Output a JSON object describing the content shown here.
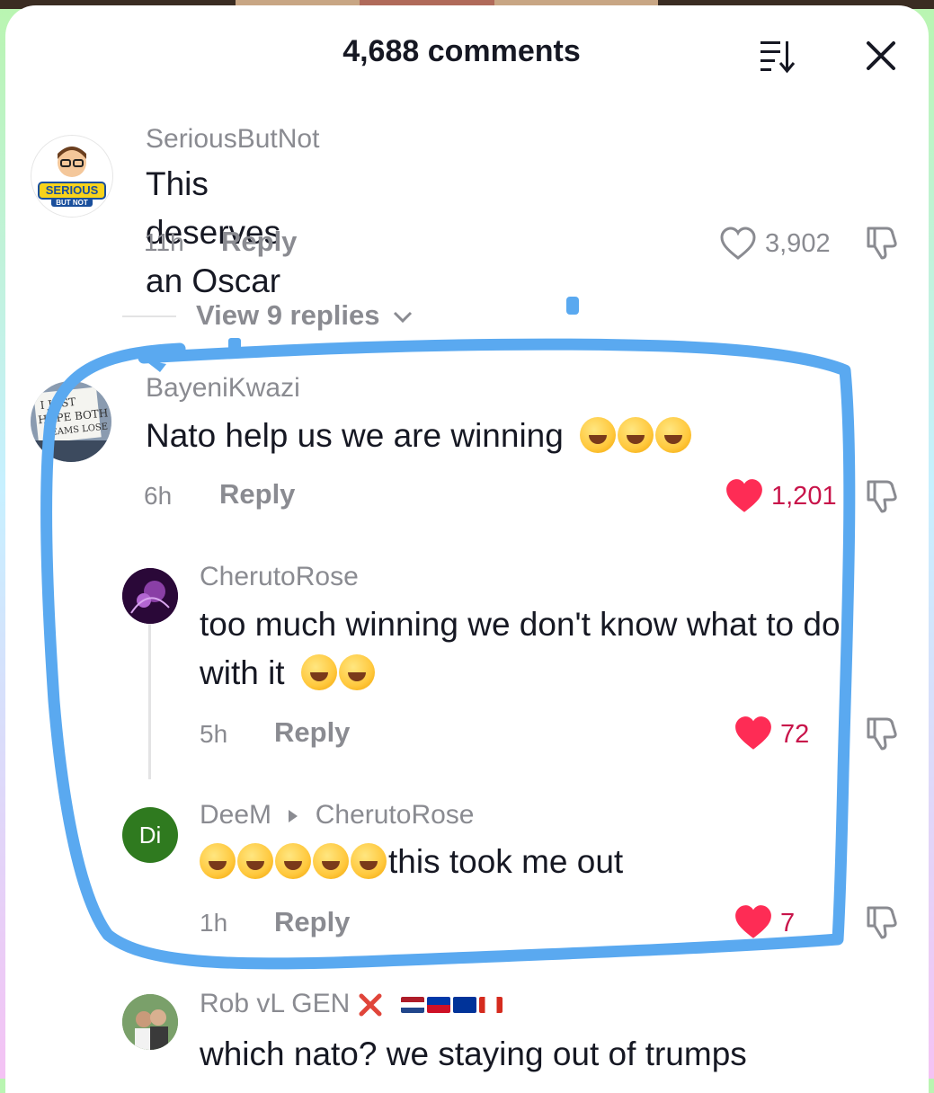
{
  "header": {
    "title": "4,688 comments"
  },
  "comments": [
    {
      "username": "SeriousButNot",
      "avatar_text": "SERIOUS BUT NOT",
      "text": "This deserves an Oscar",
      "time": "11h",
      "reply_label": "Reply",
      "likes": "3,902",
      "liked": false
    },
    {
      "username": "BayeniKwazi",
      "avatar_text": "I JUST HOPE BOTH TEAMS LOSE",
      "text": "Nato help us we are winning",
      "emoji_count": 3,
      "time": "6h",
      "reply_label": "Reply",
      "likes": "1,201",
      "liked": true
    }
  ],
  "view_replies": "View 9 replies",
  "replies": [
    {
      "username": "CherutoRose",
      "text": "too much winning we don't know what to do with it",
      "emoji_count": 2,
      "time": "5h",
      "reply_label": "Reply",
      "likes": "72",
      "liked": true
    },
    {
      "username": "DeeM",
      "reply_to": "CherutoRose",
      "avatar_initials": "Di",
      "emoji_prefix_count": 5,
      "text": "this took me out",
      "time": "1h",
      "reply_label": "Reply",
      "likes": "7",
      "liked": true
    }
  ],
  "partial_comment": {
    "username": "Rob vL GEN",
    "text": "which nato? we staying out of trumps"
  },
  "colors": {
    "like_red": "#fe2c55",
    "count_red": "#c8144a",
    "meta_grey": "#8a8b91",
    "scribble_blue": "#5aa9f0",
    "deem_avatar_green": "#2f7a1f"
  }
}
